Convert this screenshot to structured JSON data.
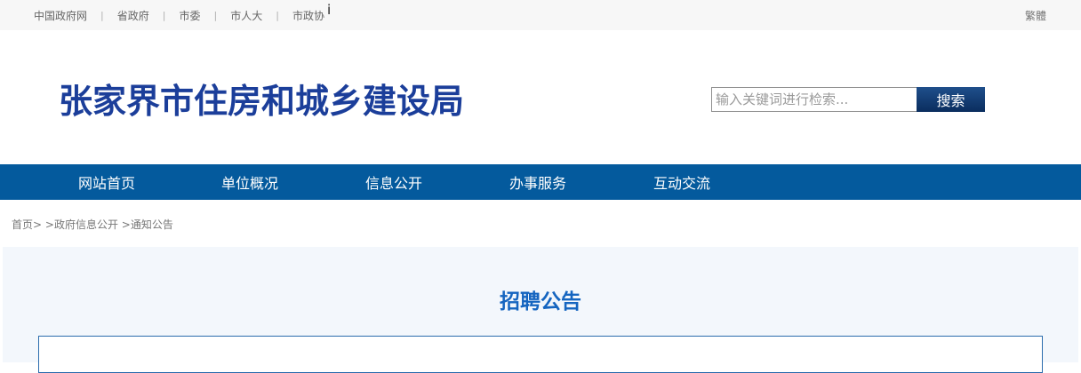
{
  "topbar": {
    "links": [
      "中国政府网",
      "省政府",
      "市委",
      "市人大",
      "市政协"
    ],
    "separator": "|",
    "cursor_glyph": "i",
    "traditional_label": "繁體"
  },
  "header": {
    "site_title": "张家界市住房和城乡建设局",
    "search": {
      "placeholder": "输入关键词进行检索...",
      "button_label": "搜索"
    }
  },
  "nav": {
    "items": [
      "网站首页",
      "单位概况",
      "信息公开",
      "办事服务",
      "互动交流"
    ]
  },
  "breadcrumb": {
    "home": "首页>",
    "level1": ">政府信息公开",
    "level2": ">通知公告"
  },
  "article": {
    "title": "招聘公告"
  },
  "colors": {
    "title_blue": "#1b3e9a",
    "nav_blue": "#045a9d",
    "article_title_blue": "#1565c0",
    "panel_bg": "#f3f7fc"
  }
}
